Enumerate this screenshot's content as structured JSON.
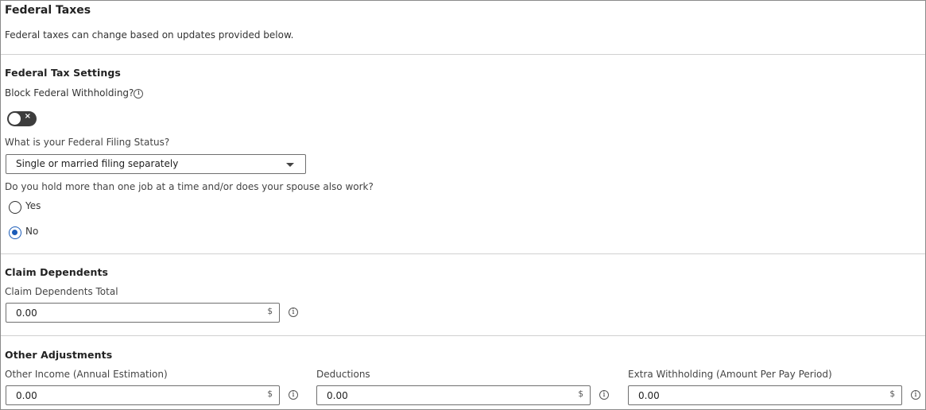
{
  "header": {
    "title": "Federal Taxes",
    "description": "Federal taxes can change based on updates provided below."
  },
  "settings": {
    "heading": "Federal Tax Settings",
    "block_label": "Block Federal Withholding?",
    "block_toggle_state": "off",
    "toggle_glyph": "×",
    "filing_status_label": "What is your Federal Filing Status?",
    "filing_status_value": "Single or married filing separately",
    "multiple_jobs_question": "Do you hold more than one job at a time and/or does your spouse also work?",
    "options": [
      {
        "label": "Yes",
        "selected": false
      },
      {
        "label": "No",
        "selected": true
      }
    ]
  },
  "dependents": {
    "heading": "Claim Dependents",
    "total_label": "Claim Dependents Total",
    "total_value": "0.00",
    "unit": "$"
  },
  "adjustments": {
    "heading": "Other Adjustments",
    "fields": [
      {
        "label": "Other Income (Annual Estimation)",
        "value": "0.00",
        "unit": "$"
      },
      {
        "label": "Deductions",
        "value": "0.00",
        "unit": "$"
      },
      {
        "label": "Extra Withholding (Amount Per Pay Period)",
        "value": "0.00",
        "unit": "$"
      }
    ]
  },
  "icons": {
    "info": "info-circle-icon",
    "dropdown": "caret-down-icon"
  },
  "colors": {
    "accent": "#1a5bb8",
    "toggle_off": "#3d3d3d",
    "divider": "#d0d0d0"
  }
}
